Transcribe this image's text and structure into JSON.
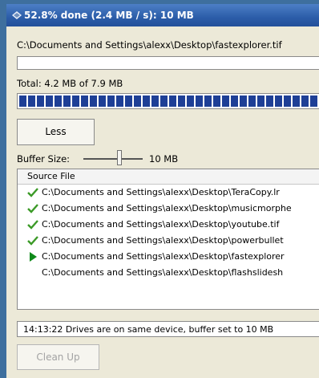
{
  "title_bar": {
    "text": "52.8% done (2.4 MB / s): 10 MB"
  },
  "current_file": "C:\\Documents and Settings\\alexx\\Desktop\\fastexplorer.tif",
  "total": {
    "text": "Total: 4.2 MB of 7.9 MB",
    "progress_percent": 52.8
  },
  "less_button": {
    "label": "Less"
  },
  "buffer": {
    "label": "Buffer Size:",
    "value": "10 MB"
  },
  "file_list": {
    "header": "Source File",
    "rows": [
      {
        "status": "done",
        "path": "C:\\Documents and Settings\\alexx\\Desktop\\TeraCopy.lr"
      },
      {
        "status": "done",
        "path": "C:\\Documents and Settings\\alexx\\Desktop\\musicmorphe"
      },
      {
        "status": "done",
        "path": "C:\\Documents and Settings\\alexx\\Desktop\\youtube.tif"
      },
      {
        "status": "done",
        "path": "C:\\Documents and Settings\\alexx\\Desktop\\powerbullet"
      },
      {
        "status": "in-progress",
        "path": "C:\\Documents and Settings\\alexx\\Desktop\\fastexplorer"
      },
      {
        "status": "pending",
        "path": "C:\\Documents and Settings\\alexx\\Desktop\\flashslidesh"
      }
    ]
  },
  "status_log": "14:13:22 Drives are on same device, buffer set to 10 MB",
  "cleanup_button": {
    "label": "Clean Up",
    "enabled": false
  },
  "icons": {
    "title": "teracopy-icon",
    "done": "checkmark-icon",
    "in_progress": "play-arrow-icon"
  },
  "colors": {
    "titlebar": "#2c5da9",
    "progress_fill": "#1e3f96",
    "check": "#3b9a27",
    "arrow": "#0f8a1a"
  }
}
